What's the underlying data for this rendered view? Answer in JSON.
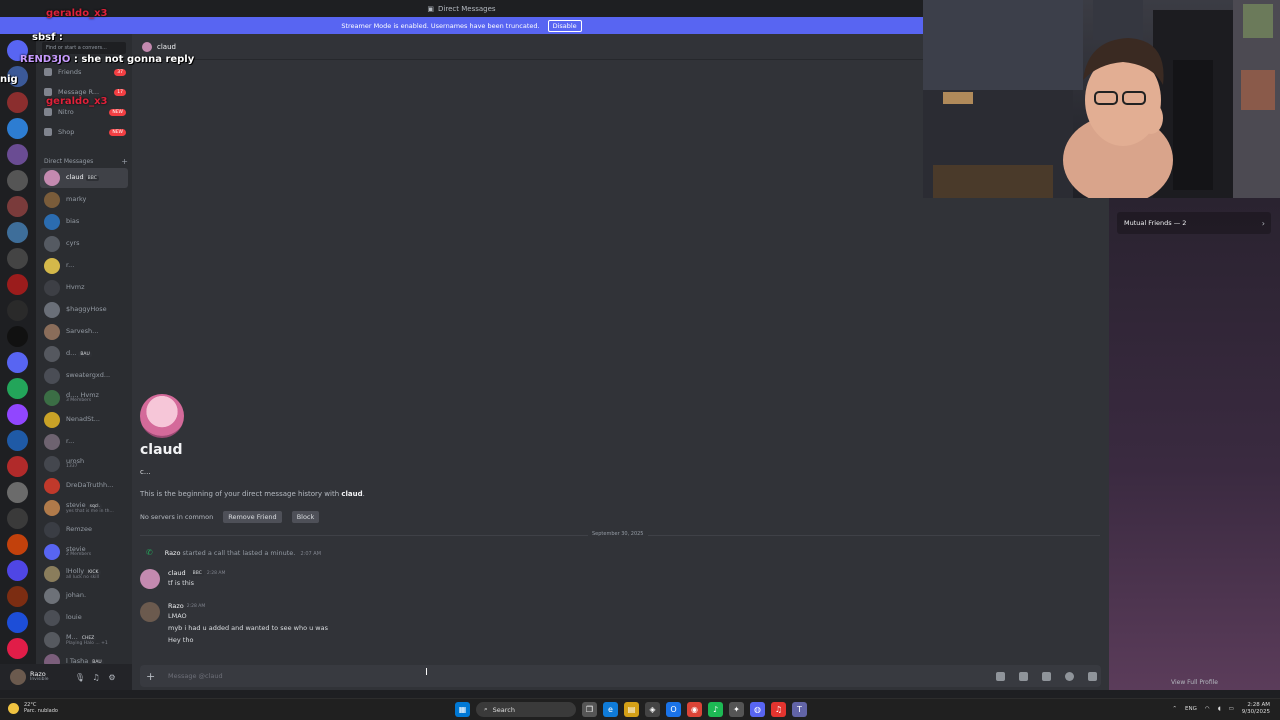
{
  "window": {
    "title": "Direct Messages"
  },
  "banner": {
    "text": "Streamer Mode is enabled. Usernames have been truncated.",
    "button": "Disable"
  },
  "sidebar": {
    "search_placeholder": "Find or start a convers...",
    "nav": [
      {
        "label": "Friends",
        "badge": "37",
        "icon": "friends-icon"
      },
      {
        "label": "Message R...",
        "badge": "17",
        "icon": "message-requests-icon"
      },
      {
        "label": "Nitro",
        "badge": "NEW",
        "icon": "nitro-icon"
      },
      {
        "label": "Shop",
        "badge": "NEW",
        "icon": "shop-icon"
      }
    ],
    "dm_header": "Direct Messages",
    "dms": [
      {
        "name": "claud",
        "tag": "BBC",
        "sub": "",
        "color": "#c48ab0"
      },
      {
        "name": "marky",
        "tag": "",
        "sub": "",
        "color": "#7a5c3a"
      },
      {
        "name": "bias",
        "tag": "",
        "sub": "",
        "color": "#2b6cb0"
      },
      {
        "name": "cyrs",
        "tag": "",
        "sub": "",
        "color": "#555a62"
      },
      {
        "name": "r...",
        "tag": "",
        "sub": "",
        "color": "#d4b84a"
      },
      {
        "name": "Hvmz",
        "tag": "",
        "sub": "",
        "color": "#3d3f45"
      },
      {
        "name": "$haggyHose",
        "tag": "",
        "sub": "",
        "color": "#6a6f78"
      },
      {
        "name": "Sarvesh...",
        "tag": "",
        "sub": "",
        "color": "#8a6d5a"
      },
      {
        "name": "d...",
        "tag": "BAU",
        "sub": "",
        "color": "#55585f"
      },
      {
        "name": "sweatergxd...",
        "tag": "",
        "sub": "",
        "color": "#4a4d55"
      },
      {
        "name": "d..., Hvmz",
        "tag": "",
        "sub": "3 Members",
        "color": "#3b6e45"
      },
      {
        "name": "NenadSt...",
        "tag": "",
        "sub": "",
        "color": "#c9a227"
      },
      {
        "name": "r...",
        "tag": "",
        "sub": "",
        "color": "#6e6370"
      },
      {
        "name": "urosh",
        "tag": "",
        "sub": "1337",
        "color": "#44474e"
      },
      {
        "name": "DreDaTruthh...",
        "tag": "",
        "sub": "",
        "color": "#c0392b"
      },
      {
        "name": "stevie",
        "tag": "sqcl.",
        "sub": "yes that is me in th...",
        "color": "#b07a4a"
      },
      {
        "name": "Remzee",
        "tag": "",
        "sub": "",
        "color": "#3a3d44"
      },
      {
        "name": "stevie",
        "tag": "",
        "sub": "2 Members",
        "color": "#5865f2"
      },
      {
        "name": "lHolly",
        "tag": "KICK",
        "sub": "all luck no skill",
        "color": "#8a7d5c"
      },
      {
        "name": "johan.",
        "tag": "",
        "sub": "",
        "color": "#6d7178"
      },
      {
        "name": "louie",
        "tag": "",
        "sub": "",
        "color": "#4b4e55"
      },
      {
        "name": "M...",
        "tag": "CHEZ",
        "sub": "Playing Halo ... +1",
        "color": "#56595f"
      },
      {
        "name": "l Tasha",
        "tag": "BAU",
        "sub": "",
        "color": "#7b5e7b"
      }
    ]
  },
  "user_panel": {
    "name": "Razo",
    "status": "Invisible"
  },
  "chat": {
    "recipient": "claud",
    "intro_name": "claud",
    "intro_username": "c...",
    "intro_text_prefix": "This is the beginning of your direct message history with",
    "intro_text_name": "claud",
    "intro_text_suffix": ".",
    "no_servers": "No servers in common",
    "remove_friend": "Remove Friend",
    "block": "Block",
    "date_divider": "September 30, 2025",
    "call": {
      "caller": "Razo",
      "text": "started a call that lasted a minute.",
      "time": "2:07 AM"
    },
    "messages": [
      {
        "author": "claud",
        "tag": "BBC",
        "time": "2:28 AM",
        "lines": [
          "tf is this"
        ],
        "avatar_color": "#c48ab0"
      },
      {
        "author": "Razo",
        "tag": "",
        "time": "2:28 AM",
        "lines": [
          "LMAO",
          "myb i had u added and wanted to see who u was",
          "Hey tho"
        ],
        "avatar_color": "#6b5a4e"
      }
    ],
    "composer_placeholder": "Message @claud"
  },
  "profile": {
    "mutual_friends": "Mutual Friends — 2",
    "view_full": "View Full Profile"
  },
  "overlay": {
    "lines": [
      {
        "user": "geraldo_x3",
        "text": ""
      },
      {
        "user": "sbsf",
        "text": ":"
      },
      {
        "user": "REND3JO",
        "text": ": she not gonna reply"
      },
      {
        "user": "nig",
        "text": ""
      },
      {
        "user": "geraldo_x3",
        "text": ""
      }
    ]
  },
  "taskbar": {
    "weather_temp": "22°C",
    "weather_desc": "Parc. nublado",
    "search": "Search",
    "lang": "ENG",
    "time": "2:28 AM",
    "date": "9/30/2025"
  }
}
